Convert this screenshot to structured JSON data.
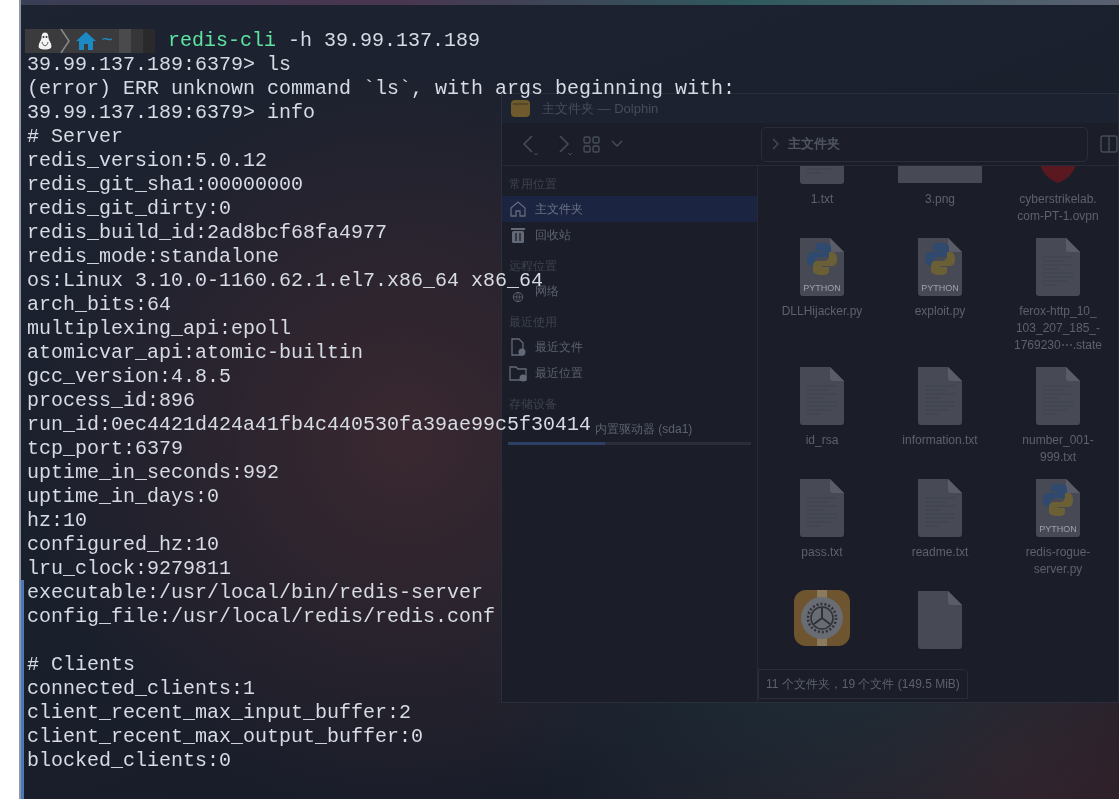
{
  "terminal": {
    "prompt": {
      "directory": "~",
      "command": "redis-cli",
      "arguments": "-h 39.99.137.189"
    },
    "blocks": [
      [
        "39.99.137.189:6379> ls",
        "(error) ERR unknown command `ls`, with args beginning with:",
        "39.99.137.189:6379> info",
        "# Server",
        "redis_version:5.0.12",
        "redis_git_sha1:00000000",
        "redis_git_dirty:0",
        "redis_build_id:2ad8bcf68fa4977",
        "redis_mode:standalone",
        "os:Linux 3.10.0-1160.62.1.el7.x86_64 x86_64",
        "arch_bits:64",
        "multiplexing_api:epoll",
        "atomicvar_api:atomic-builtin",
        "gcc_version:4.8.5",
        "process_id:896",
        "run_id:0ec4421d424a41fb4c440530fa39ae99c5f30414",
        "tcp_port:6379",
        "uptime_in_seconds:992",
        "uptime_in_days:0",
        "hz:10",
        "configured_hz:10",
        "lru_clock:9279811",
        "executable:/usr/local/bin/redis-server",
        "config_file:/usr/local/redis/redis.conf"
      ],
      [
        "# Clients",
        "connected_clients:1",
        "client_recent_max_input_buffer:2",
        "client_recent_max_output_buffer:0",
        "blocked_clients:0"
      ]
    ]
  },
  "dolphin": {
    "title": "主文件夹 — Dolphin",
    "location": "主文件夹",
    "sidebar": [
      {
        "heading": "常用位置",
        "items": [
          {
            "label": "主文件夹",
            "kind": "home",
            "selected": true
          },
          {
            "label": "回收站",
            "kind": "trash",
            "selected": false
          }
        ]
      },
      {
        "heading": "远程位置",
        "items": [
          {
            "label": "网络",
            "kind": "network",
            "selected": false
          }
        ]
      },
      {
        "heading": "最近使用",
        "items": [
          {
            "label": "最近文件",
            "kind": "recent-files",
            "selected": false
          },
          {
            "label": "最近位置",
            "kind": "recent-locations",
            "selected": false
          }
        ]
      },
      {
        "heading": "存储设备",
        "items": [
          {
            "label": "内置驱动器 (sda1)",
            "kind": "drive",
            "selected": false,
            "level": 0.4
          }
        ]
      }
    ],
    "files": [
      {
        "name": [
          "1.txt"
        ],
        "kind": "text"
      },
      {
        "name": [
          "3.png"
        ],
        "kind": "image"
      },
      {
        "name": [
          "cyberstrikelab.",
          "com-PT-1.ovpn"
        ],
        "kind": "vpn"
      },
      {
        "name": [
          "DLLHijacker.py"
        ],
        "kind": "python",
        "badge": "PYTHON"
      },
      {
        "name": [
          "exploit.py"
        ],
        "kind": "python",
        "badge": "PYTHON"
      },
      {
        "name": [
          "ferox-http_10_",
          "103_207_185_-",
          "1769230⋯.state"
        ],
        "kind": "text"
      },
      {
        "name": [
          "id_rsa"
        ],
        "kind": "text"
      },
      {
        "name": [
          "information.txt"
        ],
        "kind": "text"
      },
      {
        "name": [
          "number_001-",
          "999.txt"
        ],
        "kind": "text"
      },
      {
        "name": [
          "pass.txt"
        ],
        "kind": "text"
      },
      {
        "name": [
          "readme.txt"
        ],
        "kind": "text"
      },
      {
        "name": [
          "redis-rogue-",
          "server.py"
        ],
        "kind": "python",
        "badge": "PYTHON"
      },
      {
        "kind": "app"
      },
      {
        "kind": "blank"
      }
    ],
    "status": "11 个文件夹，19 个文件 (149.5 MiB)"
  }
}
